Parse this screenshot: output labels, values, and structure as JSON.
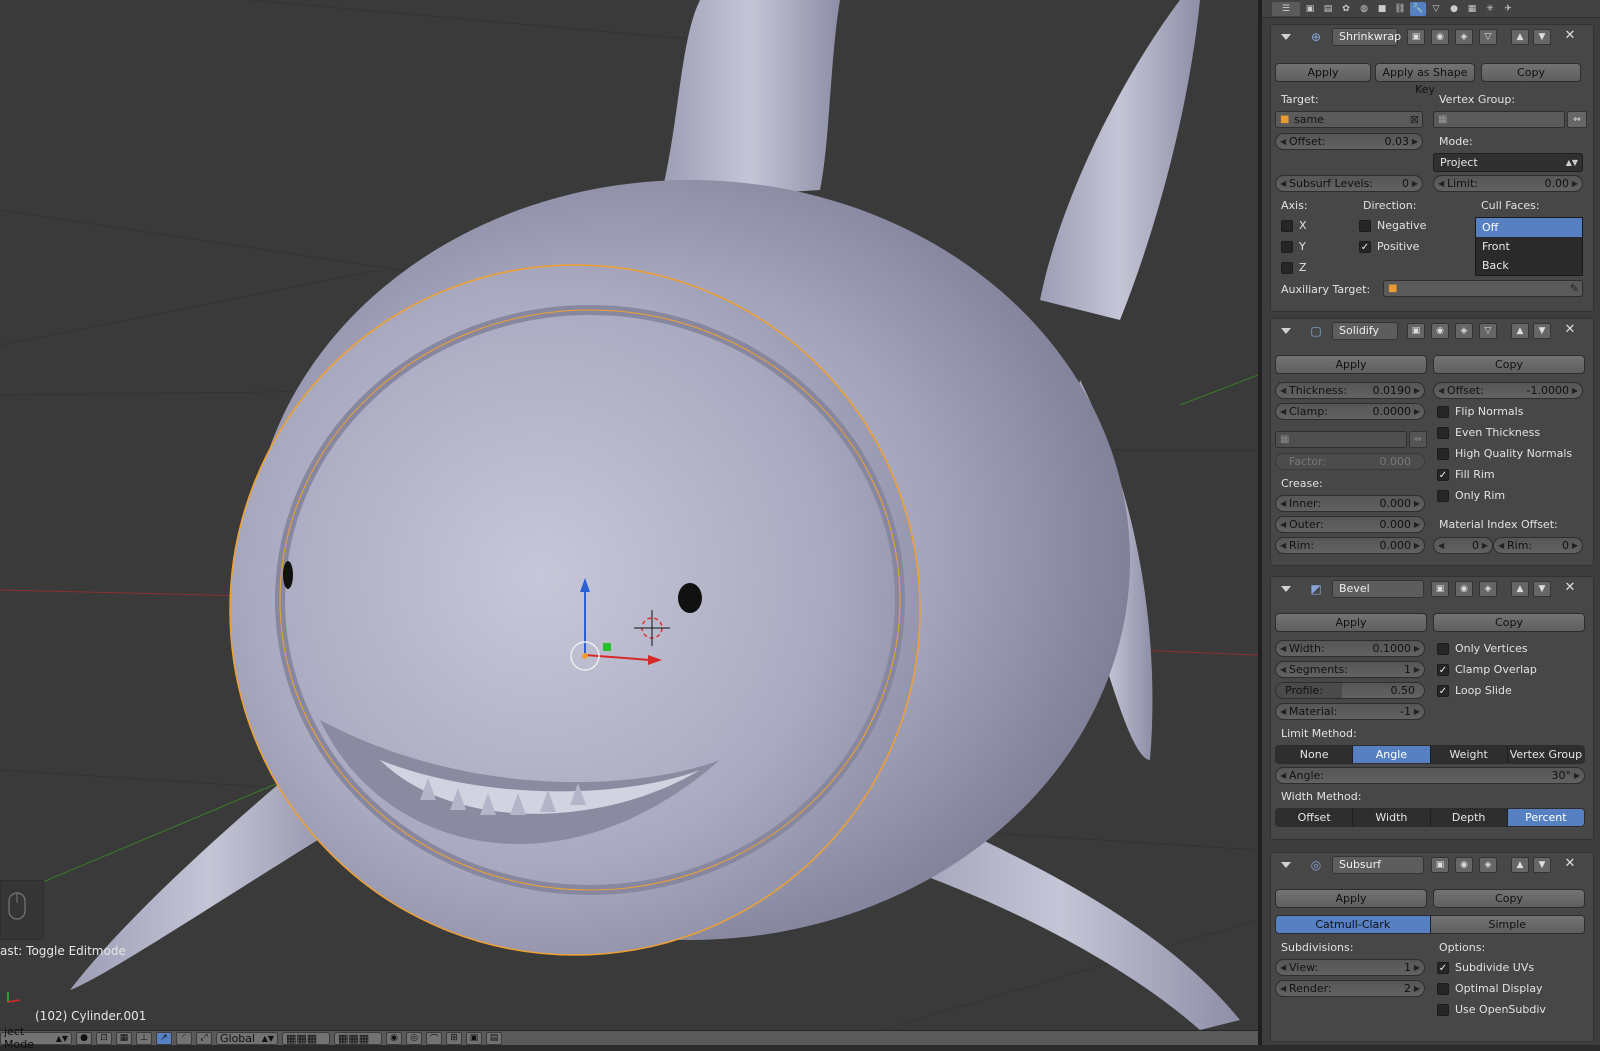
{
  "viewport": {
    "last_operator": "ast: Toggle Editmode",
    "object_info": "(102) Cylinder.001"
  },
  "bottombar": {
    "mode": "ject Mode",
    "orientation": "Global"
  },
  "colors": {
    "accent": "#5680c2",
    "selection": "#f0a030"
  },
  "properties": {
    "tabs": [
      "render-icon",
      "render-layers-icon",
      "scene-icon",
      "world-icon",
      "object-icon",
      "constraints-icon",
      "modifiers-icon",
      "data-icon",
      "material-icon",
      "texture-icon",
      "particles-icon",
      "physics-icon"
    ],
    "active_tab": "modifiers-icon",
    "shrinkwrap": {
      "name": "Shrinkwrap",
      "apply": "Apply",
      "apply_shape": "Apply as Shape Key",
      "copy": "Copy",
      "target_label": "Target:",
      "target_value": "same",
      "vgroup_label": "Vertex Group:",
      "offset_label": "Offset:",
      "offset_value": "0.03",
      "mode_label": "Mode:",
      "mode_value": "Project",
      "subsurf_label": "Subsurf Levels:",
      "subsurf_value": "0",
      "limit_label": "Limit:",
      "limit_value": "0.00",
      "axis_label": "Axis:",
      "direction_label": "Direction:",
      "cull_label": "Cull Faces:",
      "axis_x": "X",
      "axis_y": "Y",
      "axis_z": "Z",
      "negative": "Negative",
      "positive": "Positive",
      "cull_options": [
        "Off",
        "Front",
        "Back"
      ],
      "cull_selected": "Off",
      "aux_label": "Auxiliary Target:"
    },
    "solidify": {
      "name": "Solidify",
      "apply": "Apply",
      "copy": "Copy",
      "thickness_label": "Thickness:",
      "thickness_value": "0.0190",
      "offset_label": "Offset:",
      "offset_value": "-1.0000",
      "clamp_label": "Clamp:",
      "clamp_value": "0.0000",
      "factor_label": "Factor:",
      "factor_value": "0.000",
      "crease_label": "Crease:",
      "inner_label": "Inner:",
      "inner_value": "0.000",
      "outer_label": "Outer:",
      "outer_value": "0.000",
      "rim_label": "Rim:",
      "rim_value": "0.000",
      "flip_normals": "Flip Normals",
      "even_thickness": "Even Thickness",
      "hq_normals": "High Quality Normals",
      "fill_rim": "Fill Rim",
      "only_rim": "Only Rim",
      "mat_offset_label": "Material Index Offset:",
      "mat_offset_value": "0",
      "mat_rim_label": "Rim:",
      "mat_rim_value": "0"
    },
    "bevel": {
      "name": "Bevel",
      "apply": "Apply",
      "copy": "Copy",
      "width_label": "Width:",
      "width_value": "0.1000",
      "segments_label": "Segments:",
      "segments_value": "1",
      "profile_label": "Profile:",
      "profile_value": "0.50",
      "material_label": "Material:",
      "material_value": "-1",
      "only_vertices": "Only Vertices",
      "clamp_overlap": "Clamp Overlap",
      "loop_slide": "Loop Slide",
      "limit_label": "Limit Method:",
      "limit_options": [
        "None",
        "Angle",
        "Weight",
        "Vertex Group"
      ],
      "limit_selected": "Angle",
      "angle_label": "Angle:",
      "angle_value": "30°",
      "width_method_label": "Width Method:",
      "width_options": [
        "Offset",
        "Width",
        "Depth",
        "Percent"
      ],
      "width_selected": "Percent"
    },
    "subsurf": {
      "name": "Subsurf",
      "apply": "Apply",
      "copy": "Copy",
      "type_options": [
        "Catmull-Clark",
        "Simple"
      ],
      "type_selected": "Catmull-Clark",
      "subdivisions_label": "Subdivisions:",
      "options_label": "Options:",
      "view_label": "View:",
      "view_value": "1",
      "render_label": "Render:",
      "render_value": "2",
      "subdivide_uvs": "Subdivide UVs",
      "optimal_display": "Optimal Display",
      "use_opensubdiv": "Use OpenSubdiv"
    }
  }
}
